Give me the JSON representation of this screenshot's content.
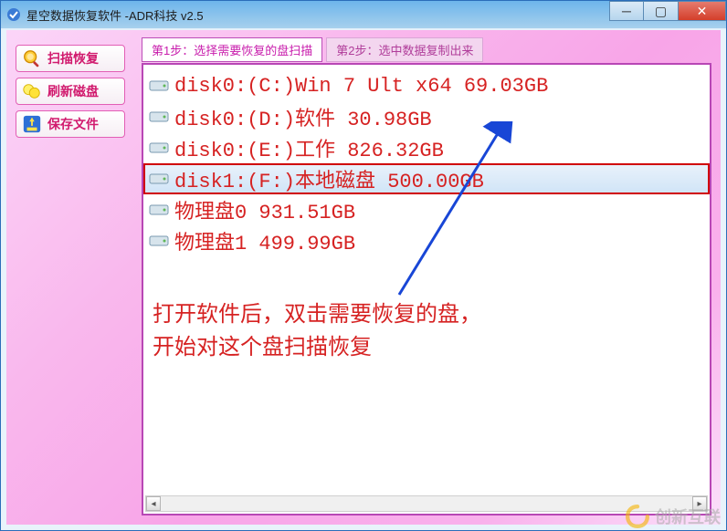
{
  "window": {
    "title": "星空数据恢复软件   -ADR科技 v2.5"
  },
  "sidebar": {
    "items": [
      {
        "label": "扫描恢复"
      },
      {
        "label": "刷新磁盘"
      },
      {
        "label": "保存文件"
      }
    ]
  },
  "tabs": [
    {
      "label": "第1步：选择需要恢复的盘扫描",
      "active": true
    },
    {
      "label": "第2步：选中数据复制出来",
      "active": false
    }
  ],
  "drives": [
    {
      "text": "disk0:(C:)Win 7 Ult x64 69.03GB",
      "selected": false
    },
    {
      "text": "disk0:(D:)软件 30.98GB",
      "selected": false
    },
    {
      "text": "disk0:(E:)工作 826.32GB",
      "selected": false
    },
    {
      "text": "disk1:(F:)本地磁盘 500.00GB",
      "selected": true
    },
    {
      "text": "物理盘0 931.51GB",
      "selected": false
    },
    {
      "text": "物理盘1 499.99GB",
      "selected": false
    }
  ],
  "instruction": {
    "line1": "打开软件后，双击需要恢复的盘，",
    "line2": "开始对这个盘扫描恢复"
  },
  "watermark": "创新互联"
}
